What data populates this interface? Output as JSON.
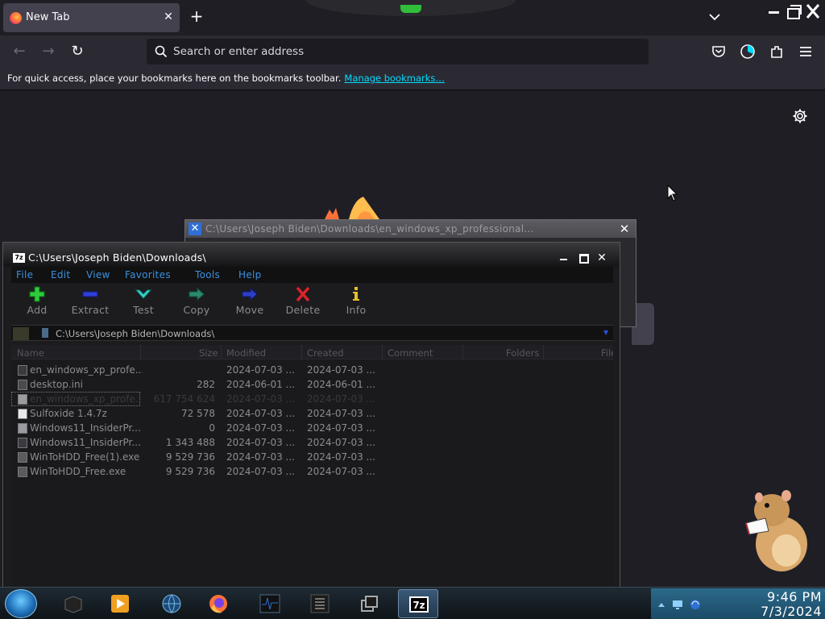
{
  "firefox": {
    "tab_title": "New Tab",
    "url_placeholder": "Search or enter address",
    "bookmarks_message": "For quick access, place your bookmarks here on the bookmarks toolbar.",
    "bookmarks_link": "Manage bookmarks…",
    "accent": "#00ddff"
  },
  "back_window": {
    "title": "C:\\Users\\Joseph Biden\\Downloads\\en_windows_xp_professional..."
  },
  "sevenzip": {
    "title": "C:\\Users\\Joseph Biden\\Downloads\\",
    "menu": [
      "File",
      "Edit",
      "View",
      "Favorites",
      "Tools",
      "Help"
    ],
    "toolbar": [
      "Add",
      "Extract",
      "Test",
      "Copy",
      "Move",
      "Delete",
      "Info"
    ],
    "address": "C:\\Users\\Joseph Biden\\Downloads\\",
    "columns": [
      "Name",
      "Size",
      "Modified",
      "Created",
      "Comment",
      "Folders",
      "File"
    ],
    "files": [
      {
        "name": "en_windows_xp_profe...",
        "size": "",
        "modified": "2024-07-03 ...",
        "created": "2024-07-03 ...",
        "icon": "file-icon"
      },
      {
        "name": "desktop.ini",
        "size": "282",
        "modified": "2024-06-01 ...",
        "created": "2024-06-01 ...",
        "icon": "ini-file-icon"
      },
      {
        "name": "en_windows_xp_profe...",
        "size": "617 754 624",
        "modified": "2024-07-03 ...",
        "created": "2024-07-03 ...",
        "icon": "iso-file-icon"
      },
      {
        "name": "Sulfoxide 1.4.7z",
        "size": "72 578",
        "modified": "2024-07-03 ...",
        "created": "2024-07-03 ...",
        "icon": "7z-archive-icon"
      },
      {
        "name": "Windows11_InsiderPr...",
        "size": "0",
        "modified": "2024-07-03 ...",
        "created": "2024-07-03 ...",
        "icon": "iso-file-icon"
      },
      {
        "name": "Windows11_InsiderPr...",
        "size": "1 343 488",
        "modified": "2024-07-03 ...",
        "created": "2024-07-03 ...",
        "icon": "file-icon"
      },
      {
        "name": "WinToHDD_Free(1).exe",
        "size": "9 529 736",
        "modified": "2024-07-03 ...",
        "created": "2024-07-03 ...",
        "icon": "exe-file-icon"
      },
      {
        "name": "WinToHDD_Free.exe",
        "size": "9 529 736",
        "modified": "2024-07-03 ...",
        "created": "2024-07-03 ...",
        "icon": "exe-file-icon"
      }
    ]
  },
  "taskbar": {
    "active_app": "7z",
    "seven_zip_label": "7z",
    "time": "9:46 PM",
    "date": "7/3/2024"
  }
}
